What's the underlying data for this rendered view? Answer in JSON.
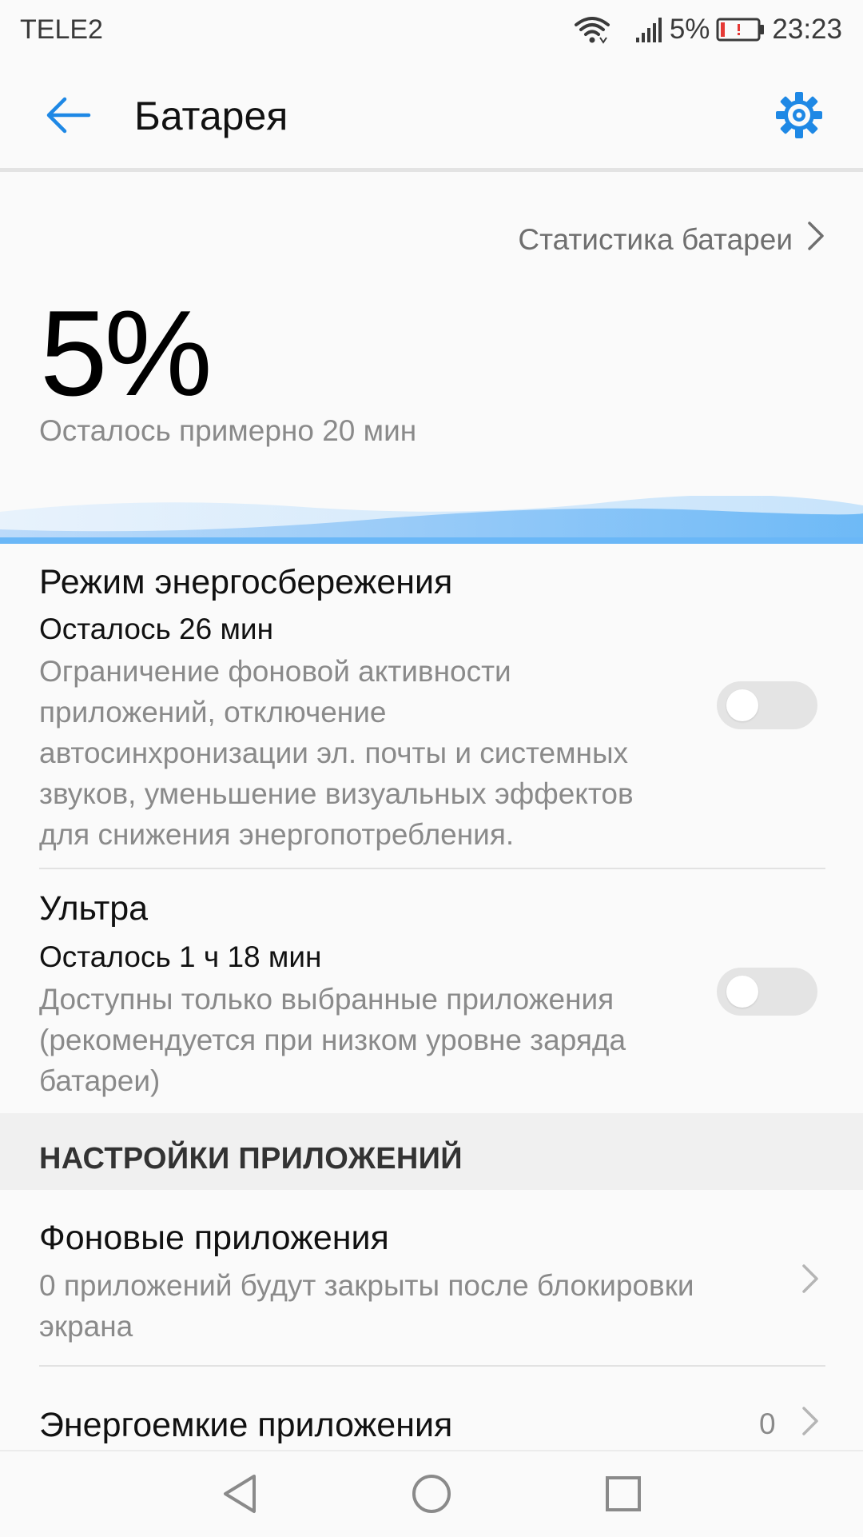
{
  "status_bar": {
    "carrier": "TELE2",
    "battery_percent": "5%",
    "time": "23:23",
    "icons": [
      "wifi-icon",
      "signal-icon",
      "battery-icon"
    ],
    "battery_level": 0.05
  },
  "app_bar": {
    "title": "Батарея",
    "back_icon": "arrow-left-icon",
    "settings_icon": "gear-icon"
  },
  "summary": {
    "stats_link": "Статистика батареи",
    "percent": "5%",
    "remaining": "Осталось примерно 20 мин"
  },
  "power_saving": {
    "title": "Режим энергосбережения",
    "remaining": "Осталось 26 мин",
    "description_lines": [
      "Ограничение фоновой активности",
      "приложений, отключение",
      "автосинхронизации эл. почты и системных",
      "звуков, уменьшение визуальных эффектов",
      "для снижения энергопотребления."
    ],
    "enabled": false
  },
  "ultra": {
    "title": "Ультра",
    "remaining": "Осталось 1 ч 18 мин",
    "description_lines": [
      "Доступны только выбранные приложения",
      "(рекомендуется при низком уровне заряда",
      "батареи)"
    ],
    "enabled": false
  },
  "app_settings": {
    "section_title": "НАСТРОЙКИ ПРИЛОЖЕНИЙ",
    "background_apps": {
      "title": "Фоновые приложения",
      "description_lines": [
        "0 приложений будут закрыты после блокировки",
        "экрана"
      ]
    },
    "power_intensive": {
      "title": "Энергоемкие приложения",
      "count": "0"
    }
  },
  "nav_bar": {
    "icons": [
      "back-triangle-icon",
      "home-circle-icon",
      "recents-square-icon"
    ]
  },
  "colors": {
    "accent": "#1e88e5",
    "battery_low": "#e53935"
  }
}
